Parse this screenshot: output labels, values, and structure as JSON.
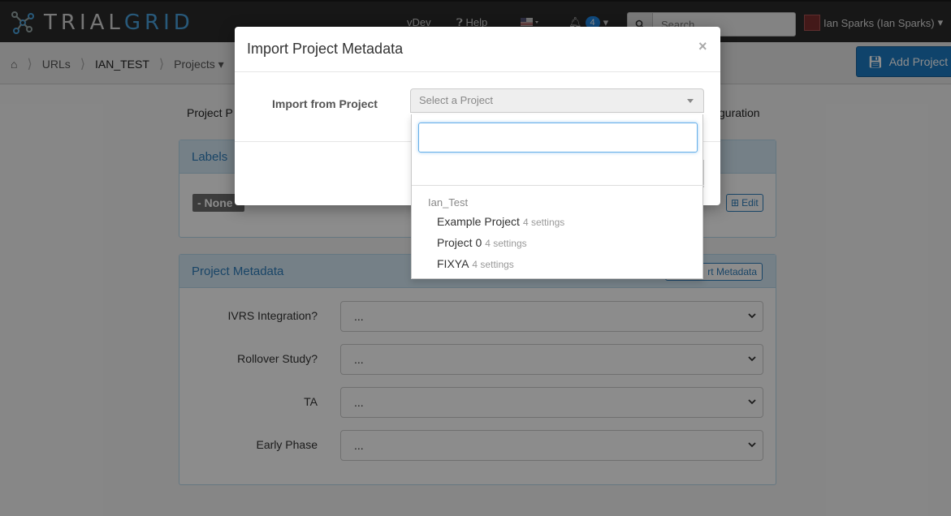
{
  "navbar": {
    "logo_text_a": "TRIAL",
    "logo_text_b": "GRID",
    "vdev": "vDev",
    "help": "Help",
    "notification_count": "4",
    "search_placeholder": "Search ...",
    "user_name": "Ian Sparks (Ian Sparks)"
  },
  "breadcrumb": {
    "items": [
      "URLs",
      "IAN_TEST",
      "Projects"
    ],
    "add_project_label": "Add Project"
  },
  "page": {
    "tab_left": "Project P",
    "tab_right": "guration",
    "labels_panel": {
      "title": "Labels",
      "none_tag": "- None -",
      "edit_label": "Edit"
    },
    "metadata_panel": {
      "title": "Project Metadata",
      "export_label": "rt Metadata",
      "fields": [
        {
          "label": "IVRS Integration?",
          "value": "..."
        },
        {
          "label": "Rollover Study?",
          "value": "..."
        },
        {
          "label": "TA",
          "value": "..."
        },
        {
          "label": "Early Phase",
          "value": "..."
        }
      ]
    }
  },
  "modal": {
    "title": "Import Project Metadata",
    "close": "×",
    "import_label": "Import from Project",
    "select_placeholder": "Select a Project",
    "dropdown": {
      "search_value": "",
      "group": "Ian_Test",
      "options": [
        {
          "name": "Example Project",
          "meta": "4 settings"
        },
        {
          "name": "Project 0",
          "meta": "4 settings"
        },
        {
          "name": "FIXYA",
          "meta": "4 settings"
        }
      ]
    }
  },
  "colors": {
    "navbar_bg": "#2b2b2b",
    "accent": "#1d7bc4",
    "panel_head": "#d6e9f6"
  }
}
